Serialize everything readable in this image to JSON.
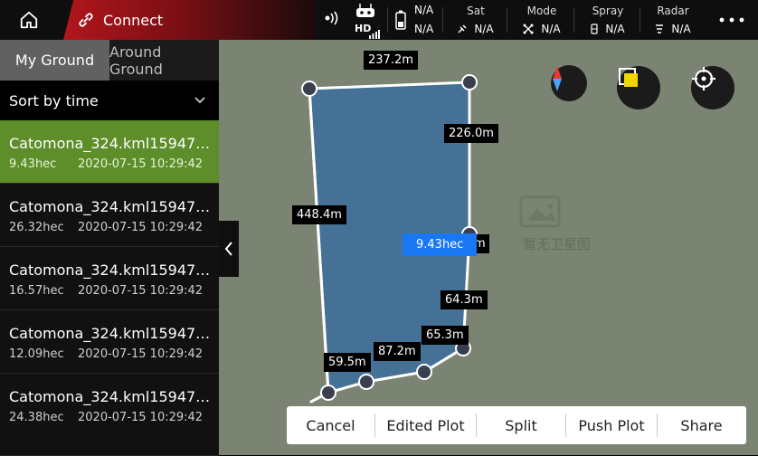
{
  "header": {
    "connect_label": "Connect",
    "battery_top": "N/A",
    "battery_bottom": "N/A",
    "stats": [
      {
        "label": "Sat",
        "value": "N/A",
        "icon": "satellite-icon"
      },
      {
        "label": "Mode",
        "value": "N/A",
        "icon": "drone-icon"
      },
      {
        "label": "Spray",
        "value": "N/A",
        "icon": "spray-icon"
      },
      {
        "label": "Radar",
        "value": "N/A",
        "icon": "radar-icon"
      }
    ],
    "hd_label": "HD"
  },
  "sidebar": {
    "tabs": [
      "My Ground",
      "Around Ground"
    ],
    "sort_label": "Sort by time",
    "items": [
      {
        "name": "Catomona_324.kml15947…",
        "area": "9.43hec",
        "date": "2020-07-15 10:29:42",
        "active": true
      },
      {
        "name": "Catomona_324.kml15947…",
        "area": "26.32hec",
        "date": "2020-07-15 10:29:42"
      },
      {
        "name": "Catomona_324.kml15947…",
        "area": "16.57hec",
        "date": "2020-07-15 10:29:42"
      },
      {
        "name": "Catomona_324.kml15947…",
        "area": "12.09hec",
        "date": "2020-07-15 10:29:42"
      },
      {
        "name": "Catomona_324.kml15947…",
        "area": "24.38hec",
        "date": "2020-07-15 10:29:42"
      }
    ]
  },
  "map": {
    "edges": [
      "237.2m",
      "226.0m",
      "448.4m",
      "64.3m",
      "65.3m",
      "87.2m",
      "59.5m"
    ],
    "hidden_edge_suffix": "m",
    "area_label": "9.43hec",
    "watermark": "暂无卫星图",
    "colors": {
      "plot_fill": "#3e6f99",
      "area_badge": "#1877f2"
    }
  },
  "actions": [
    "Cancel",
    "Edited Plot",
    "Split",
    "Push Plot",
    "Share"
  ]
}
